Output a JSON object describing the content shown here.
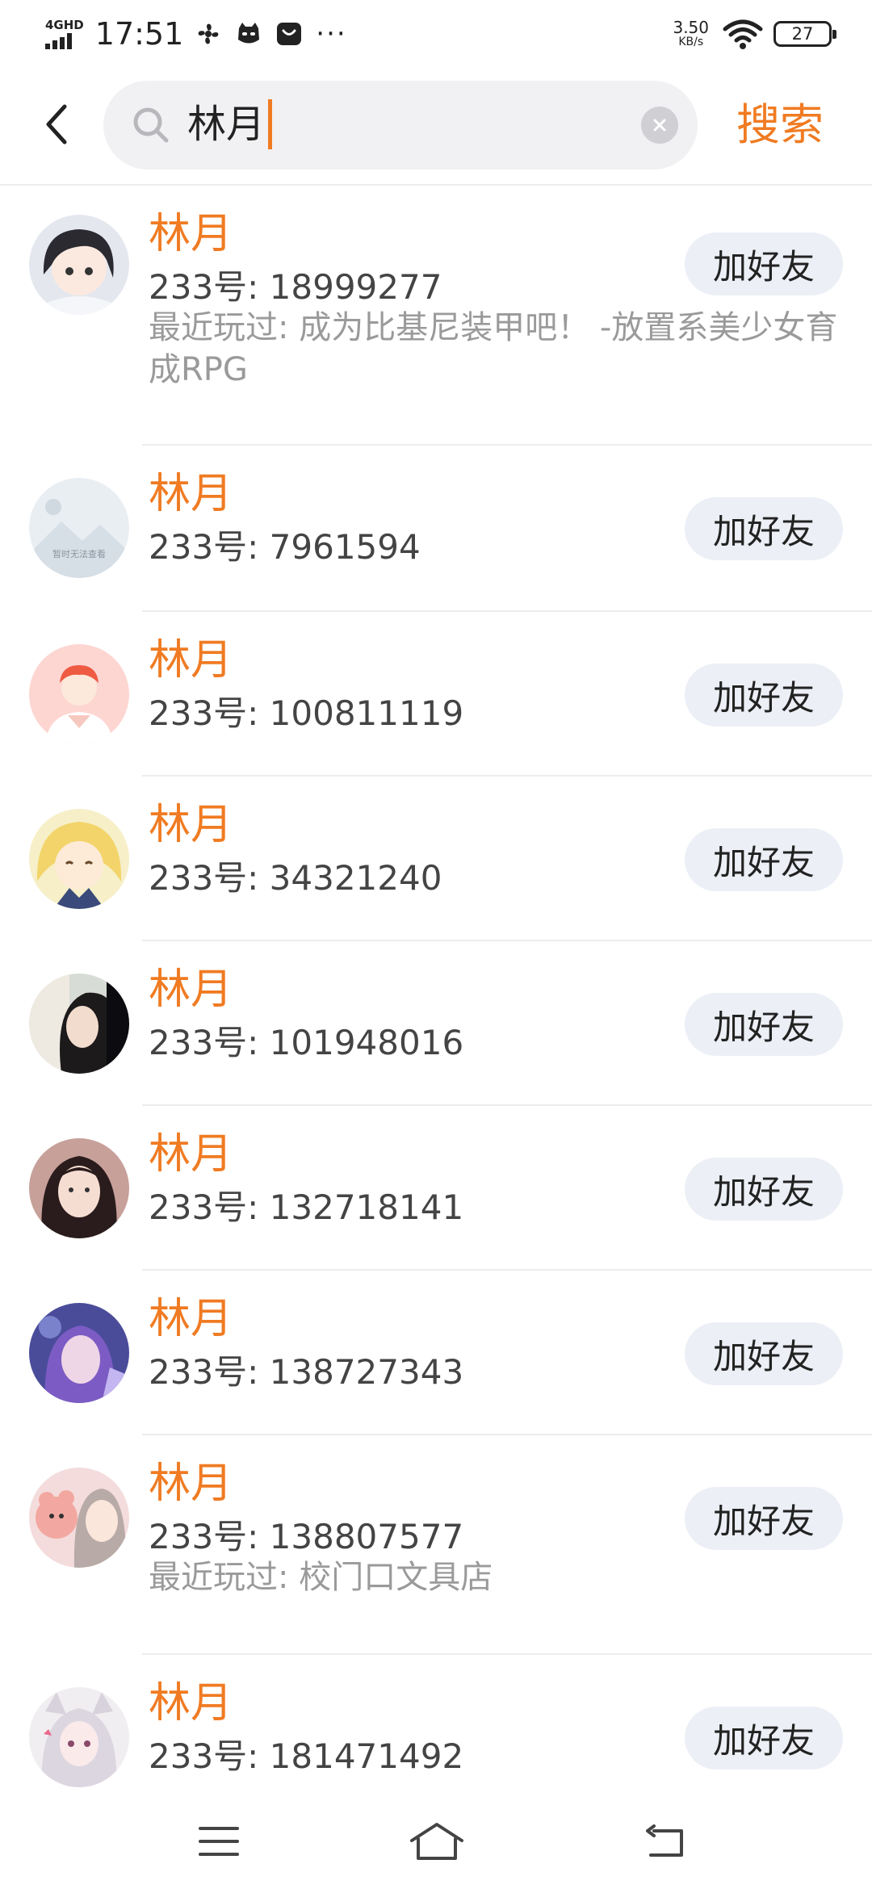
{
  "status_bar": {
    "network_type": "4GHD",
    "time": "17:51",
    "more_indicator": "···",
    "net_speed_value": "3.50",
    "net_speed_unit": "KB/s",
    "battery_level": "27"
  },
  "search": {
    "query": "林月",
    "search_button_label": "搜索"
  },
  "results": [
    {
      "name": "林月",
      "id": "233号: 18999277",
      "recent": "最近玩过: 成为比基尼装甲吧！ -放置系美少女育成RPG",
      "button": "加好友"
    },
    {
      "name": "林月",
      "id": "233号: 7961594",
      "button": "加好友",
      "avatar_placeholder_text": "暂时无法查看"
    },
    {
      "name": "林月",
      "id": "233号: 100811119",
      "button": "加好友"
    },
    {
      "name": "林月",
      "id": "233号: 34321240",
      "button": "加好友"
    },
    {
      "name": "林月",
      "id": "233号: 101948016",
      "button": "加好友"
    },
    {
      "name": "林月",
      "id": "233号: 132718141",
      "button": "加好友"
    },
    {
      "name": "林月",
      "id": "233号: 138727343",
      "button": "加好友"
    },
    {
      "name": "林月",
      "id": "233号: 138807577",
      "recent": "最近玩过: 校门口文具店",
      "button": "加好友"
    },
    {
      "name": "林月",
      "id": "233号: 181471492",
      "button": "加好友"
    }
  ],
  "colors": {
    "accent": "#f07b22",
    "button_bg": "#eceff5",
    "search_bg": "#f1f1f3",
    "secondary_text": "#9a9a9a"
  },
  "icons": {
    "back": "chevron-left-icon",
    "search": "magnifier-icon",
    "clear": "close-circle-icon",
    "nav_menu": "menu-icon",
    "nav_home": "home-icon",
    "nav_back": "back-arrow-icon"
  }
}
